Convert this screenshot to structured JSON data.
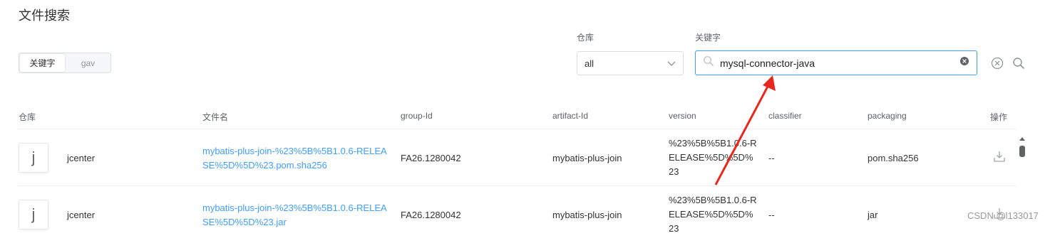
{
  "page": {
    "title": "文件搜索"
  },
  "mode_toggle": {
    "options": [
      "关键字",
      "gav"
    ],
    "selected": "关键字"
  },
  "filters": {
    "repo_label": "仓库",
    "repo_value": "all",
    "keyword_label": "关键字",
    "keyword_value": "mysql-connector-java"
  },
  "table": {
    "columns": [
      "仓库",
      "文件名",
      "group-Id",
      "artifact-Id",
      "version",
      "classifier",
      "packaging",
      "操作"
    ],
    "rows": [
      {
        "avatar": "j",
        "repo": "jcenter",
        "file": "mybatis-plus-join-%23%5B%5B1.0.6-RELEASE%5D%5D%23.pom.sha256",
        "group_id": "FA26.1280042",
        "artifact_id": "mybatis-plus-join",
        "version": "%23%5B%5B1.0.6-RELEASE%5D%5D%23",
        "classifier": "--",
        "packaging": "pom.sha256"
      },
      {
        "avatar": "j",
        "repo": "jcenter",
        "file": "mybatis-plus-join-%23%5B%5B1.0.6-RELEASE%5D%5D%23.jar",
        "group_id": "FA26.1280042",
        "artifact_id": "mybatis-plus-join",
        "version": "%23%5B%5B1.0.6-RELEASE%5D%5D%23",
        "classifier": "--",
        "packaging": "jar"
      }
    ]
  },
  "watermark": "CSDN @l133017",
  "colors": {
    "link": "#409eff",
    "annotation_arrow": "#e8281e"
  }
}
